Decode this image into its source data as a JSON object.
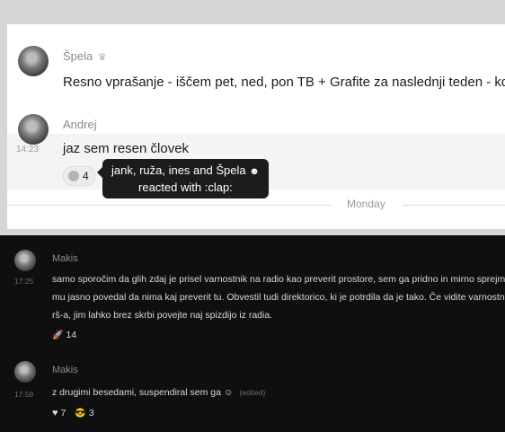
{
  "light_chat": {
    "messages": [
      {
        "author": "Špela",
        "author_emoji": "♛",
        "text": "Resno vprašanje - iščem pet, ned, pon TB + Grafite za naslednji teden - kdo ima čas"
      },
      {
        "author": "Andrej",
        "time": "14:23",
        "text": "jaz sem resen človek",
        "reaction": {
          "emoji": "clap-icon",
          "count": "4"
        }
      }
    ],
    "tooltip": {
      "line1": "jank, ruža, ines and Špela",
      "line1_emoji": "☻",
      "line2": "reacted with :clap:"
    },
    "day_divider": "Monday"
  },
  "dark_chat": {
    "messages": [
      {
        "author": "Makis",
        "time": "17:25",
        "lines": [
          "samo sporočim da glih zdaj je prisel varnostnik na radio kao preverit prostore, sem ga pridno in mirno sprejmal",
          "mu jasno povedal da nima kaj preverit tu. Obvestil tudi direktorico, ki je potrdila da je tako. Če vidite varnostnike",
          "rš-a, jim lahko brez skrbi povejte naj spizdijo iz radia."
        ],
        "reactions": [
          {
            "emoji": "rocket-icon",
            "glyph": "🚀",
            "count": "14"
          }
        ]
      },
      {
        "author": "Makis",
        "time": "17:59",
        "text": "z drugimi besedami, suspendiral sem ga",
        "text_emoji": "☺",
        "edited": "(edited)",
        "reactions": [
          {
            "emoji": "heart-icon",
            "glyph": "♥",
            "count": "7"
          },
          {
            "emoji": "sunglasses-icon",
            "glyph": "😎",
            "count": "3"
          }
        ]
      }
    ]
  },
  "colors": {
    "light_bg": "#ffffff",
    "dark_bg": "#0f0f0f",
    "tooltip_bg": "#1d1c1d",
    "outer_bg": "#d6d6d6"
  }
}
